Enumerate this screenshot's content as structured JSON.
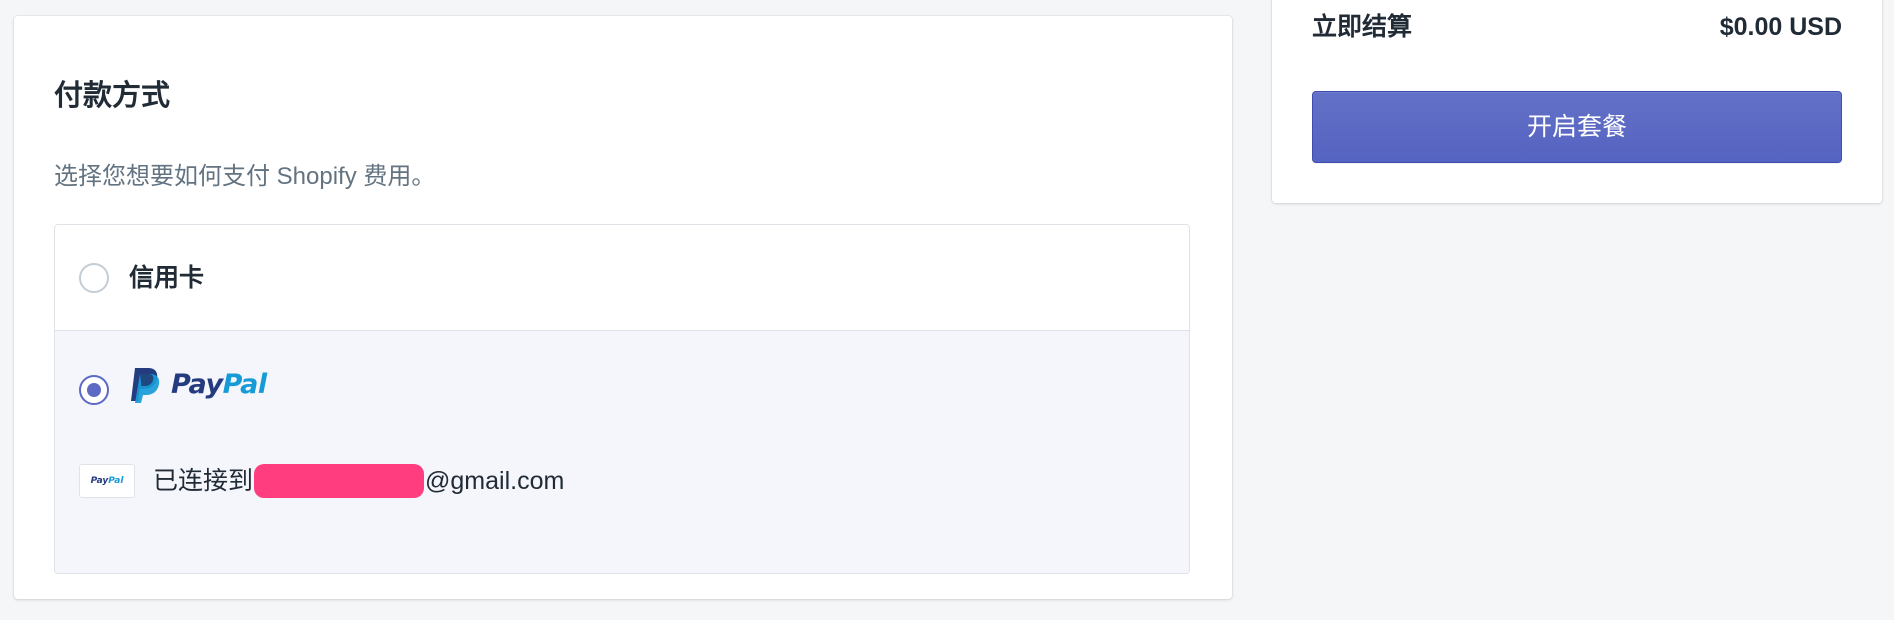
{
  "payment_method": {
    "title": "付款方式",
    "subtitle": "选择您想要如何支付 Shopify 费用。",
    "options": [
      {
        "label": "信用卡",
        "selected": false
      },
      {
        "label_pay": "Pay",
        "label_pal": "Pal",
        "selected": true,
        "connected_prefix": "已连接到",
        "connected_suffix": "@gmail.com",
        "badge_pay": "Pay",
        "badge_pal": "Pal"
      }
    ]
  },
  "summary": {
    "checkout_label": "立即结算",
    "checkout_price": "$0.00 USD",
    "start_plan_button": "开启套餐"
  },
  "colors": {
    "accent": "#5c6ac4",
    "paypal_dark_blue": "#253b80",
    "paypal_light_blue": "#179bd7",
    "redaction": "#ff3d7f",
    "background": "#f4f6f8",
    "selected_row": "#f4f6fb"
  },
  "icons": {
    "paypal_mark": "paypal-p-icon",
    "paypal_badge": "paypal-badge-icon"
  }
}
